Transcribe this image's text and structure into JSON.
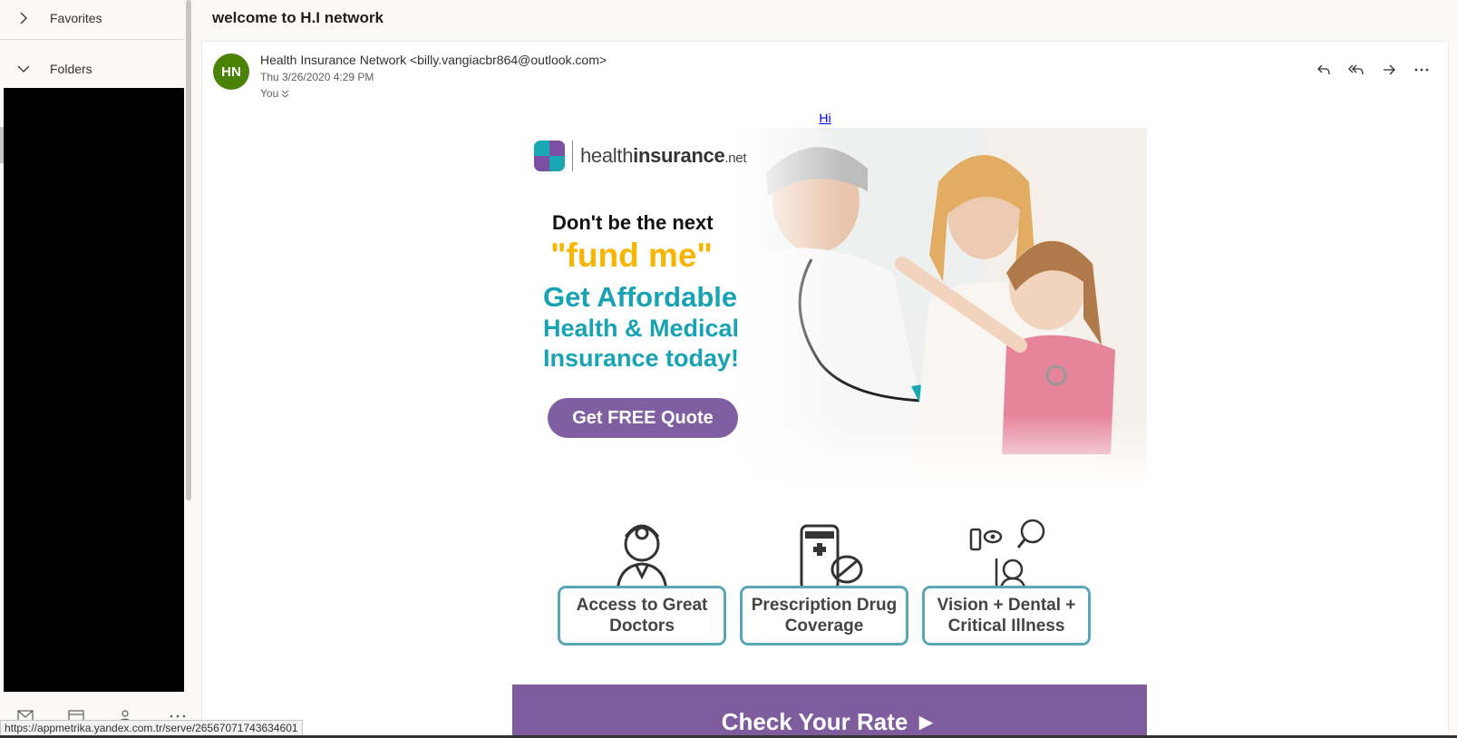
{
  "sidebar": {
    "favorites_label": "Favorites",
    "folders_label": "Folders"
  },
  "message": {
    "subject": "welcome to H.I network",
    "avatar_initials": "HN",
    "avatar_color": "#498205",
    "sender": "Health Insurance Network <billy.vangiacbr864@outlook.com>",
    "date": "Thu 3/26/2020 4:29 PM",
    "to": "You",
    "hi_link": "Hi"
  },
  "email": {
    "logo_text_light": "health",
    "logo_text_bold": "insurance",
    "logo_text_suffix": ".net",
    "headline_1": "Don't be the next",
    "headline_2": "\"fund me\"",
    "headline_3": "Get Affordable",
    "headline_4": "Health & Medical Insurance today!",
    "quote_button": "Get FREE Quote",
    "features": [
      {
        "label": "Access to Great Doctors",
        "icon": "doctor-icon"
      },
      {
        "label": "Prescription Drug Coverage",
        "icon": "pill-bottle-icon"
      },
      {
        "label": "Vision + Dental + Critical Illness",
        "icon": "vision-dental-icon"
      }
    ],
    "rate_button": "Check Your Rate ►",
    "colors": {
      "purple": "#7f5fa1",
      "teal": "#17a3b3",
      "yellow": "#f7b500"
    }
  },
  "status_bar": {
    "url": "https://appmetrika.yandex.com.tr/serve/265670717436346​01"
  }
}
